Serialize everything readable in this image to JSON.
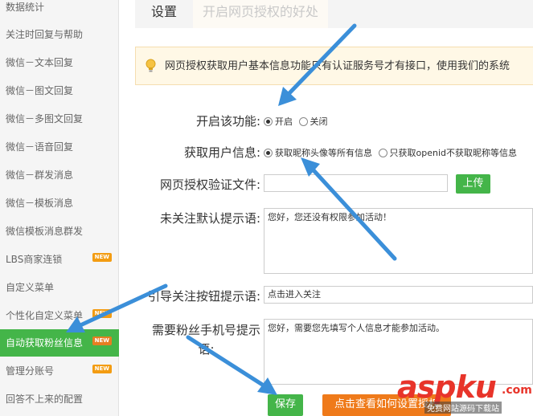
{
  "sidebar": {
    "new_badge": "NEW",
    "items": [
      {
        "label": "数据统计",
        "new": false
      },
      {
        "label": "关注时回复与帮助",
        "new": false
      },
      {
        "label": "微信－文本回复",
        "new": false
      },
      {
        "label": "微信－图文回复",
        "new": false
      },
      {
        "label": "微信－多图文回复",
        "new": false
      },
      {
        "label": "微信－语音回复",
        "new": false
      },
      {
        "label": "微信－群发消息",
        "new": false
      },
      {
        "label": "微信－模板消息",
        "new": false
      },
      {
        "label": "微信模板消息群发",
        "new": false
      },
      {
        "label": "LBS商家连锁",
        "new": true
      },
      {
        "label": "自定义菜单",
        "new": false
      },
      {
        "label": "个性化自定义菜单",
        "new": true
      },
      {
        "label": "自动获取粉丝信息",
        "new": true,
        "active": true
      },
      {
        "label": "管理分账号",
        "new": true
      },
      {
        "label": "回答不上来的配置",
        "new": false
      }
    ]
  },
  "tabs": {
    "settings": "设置",
    "benefits": "开启网页授权的好处"
  },
  "notice": {
    "icon": "lightbulb-icon",
    "text": "网页授权获取用户基本信息功能只有认证服务号才有接口，使用我们的系统"
  },
  "form": {
    "enable": {
      "label": "开启该功能:",
      "options": [
        "开启",
        "关闭"
      ],
      "selected": "开启"
    },
    "fetch_info": {
      "label": "获取用户信息:",
      "options": [
        "获取昵称头像等所有信息",
        "只获取openid不获取昵称等信息"
      ],
      "selected": "获取昵称头像等所有信息"
    },
    "verify_file": {
      "label": "网页授权验证文件:",
      "value": "",
      "upload_label": "上传"
    },
    "unfollow_tip": {
      "label": "未关注默认提示语:",
      "value": "您好，您还没有权限参加活动！"
    },
    "follow_button_tip": {
      "label": "引导关注按钮提示语:",
      "value": "点击进入关注"
    },
    "phone_tip": {
      "label_line1": "需要粉丝手机号提示",
      "label_line2": "语:",
      "value": "您好，需要您先填写个人信息才能参加活动。"
    }
  },
  "actions": {
    "save_label": "保存",
    "howto_label": "点击查看如何设置授权"
  },
  "watermark": {
    "main": "aspku",
    "suffix": ".com",
    "sub": "免费网站源码下载站"
  },
  "colors": {
    "accent_green": "#44b549",
    "orange": "#ef7a1a",
    "arrow_blue": "#3b8fd9",
    "watermark_red": "#e8342a"
  }
}
